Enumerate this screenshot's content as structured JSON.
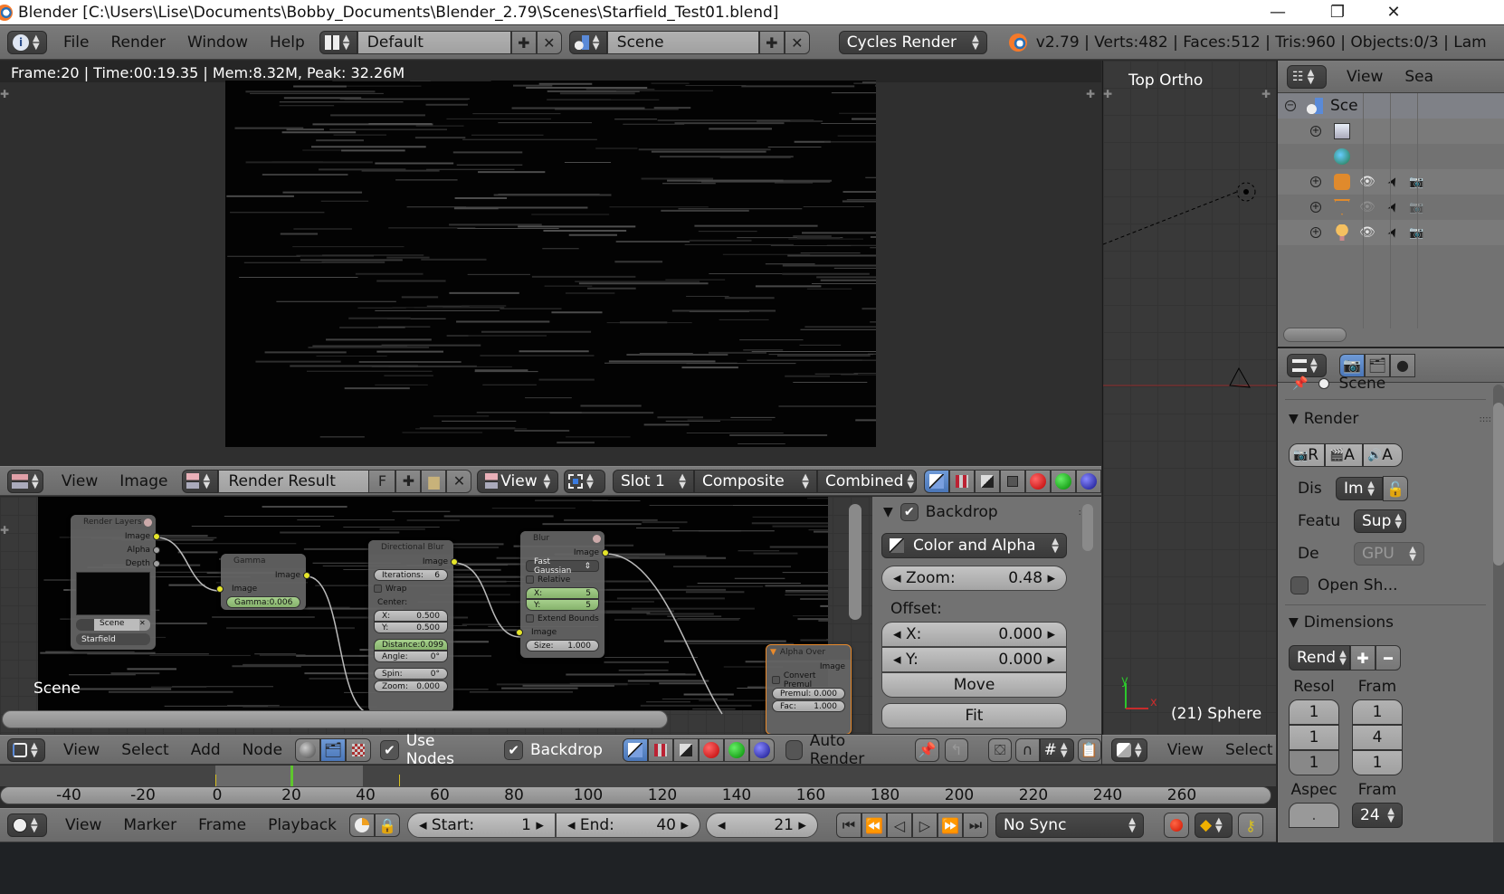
{
  "window": {
    "title": "Blender [C:\\Users\\Lise\\Documents\\Bobby_Documents\\Blender_2.79\\Scenes\\Starfield_Test01.blend]",
    "controls": {
      "minimize": "—",
      "restore": "❐",
      "close": "✕"
    }
  },
  "info_header": {
    "menus": [
      "File",
      "Render",
      "Window",
      "Help"
    ],
    "screen_layout": "Default",
    "scene": "Scene",
    "render_engine": "Cycles Render",
    "stats": "v2.79 | Verts:482 | Faces:512 | Tris:960 | Objects:0/3 | Lam"
  },
  "image_editor": {
    "render_info": "Frame:20 | Time:00:19.35 | Mem:8.32M, Peak: 32.26M",
    "header": {
      "menus": [
        "View",
        "Image"
      ],
      "image_name": "Render Result",
      "fake_user": "F",
      "view_mode": "View",
      "slot": "Slot 1",
      "layer": "Composite",
      "pass": "Combined"
    }
  },
  "viewport": {
    "label": "Top Ortho",
    "object_info": "(21) Sphere",
    "axis_x": "x",
    "axis_y": "y",
    "header": {
      "menus": [
        "View",
        "Select"
      ]
    }
  },
  "outliner": {
    "header": {
      "menus": [
        "View",
        "Sea"
      ]
    },
    "items": [
      {
        "label": "Sce",
        "icon": "scene-icon",
        "depth": 0,
        "expander": "minus"
      },
      {
        "label": "",
        "icon": "render-layers-icon",
        "depth": 1,
        "expander": "plus"
      },
      {
        "label": "",
        "icon": "world-icon",
        "depth": 1,
        "expander": ""
      },
      {
        "label": "",
        "icon": "camera-object-icon",
        "depth": 1,
        "expander": "plus",
        "visible": true
      },
      {
        "label": "",
        "icon": "mesh-object-icon",
        "depth": 1,
        "expander": "plus",
        "visible": false
      },
      {
        "label": "",
        "icon": "lamp-object-icon",
        "depth": 1,
        "expander": "plus",
        "visible": true
      }
    ]
  },
  "properties": {
    "context_path": "Scene",
    "render_panel": {
      "title": "Render",
      "buttons": [
        "R",
        "A",
        "A"
      ],
      "display_label": "Dis",
      "display_value": "Im",
      "feature_label": "Featu",
      "feature_value": "Sup",
      "device_label": "De",
      "device_value": "GPU",
      "open_shading": "Open Sh..."
    },
    "dimensions_panel": {
      "title": "Dimensions",
      "preset": "Rend",
      "resolution_label": "Resol",
      "resolution_values": [
        "1",
        "1",
        "1"
      ],
      "frame_range_label": "Fram",
      "frame_values": [
        "1",
        "4",
        "1"
      ],
      "aspect_label": "Aspec",
      "aspect_value": ".",
      "frame_rate_label": "Fram",
      "frame_rate": "24"
    }
  },
  "node_editor": {
    "scene_label": "Scene",
    "nodes": {
      "render_layers": {
        "title": "Render Layers",
        "outputs": [
          "Image",
          "Alpha",
          "Depth"
        ],
        "scene": "Scene",
        "layer": "Starfield"
      },
      "gamma": {
        "title": "Gamma",
        "output": "Image",
        "input": "Image",
        "gamma": "Gamma:",
        "gamma_value": "0.006"
      },
      "directional_blur": {
        "title": "Directional Blur",
        "output": "Image",
        "iterations_label": "Iterations:",
        "iterations": "6",
        "wrap": "Wrap",
        "center": "Center:",
        "x_label": "X:",
        "x": "0.500",
        "y_label": "Y:",
        "y": "0.500",
        "distance_label": "Distance:",
        "distance": "0.099",
        "angle_label": "Angle:",
        "angle": "0°",
        "spin_label": "Spin:",
        "spin": "0°",
        "zoom_label": "Zoom:",
        "zoom": "0.000"
      },
      "blur": {
        "title": "Blur",
        "output": "Image",
        "filter": "Fast Gaussian",
        "relative": "Relative",
        "x_label": "X:",
        "x": "5",
        "y_label": "Y:",
        "y": "5",
        "extend_bounds": "Extend Bounds",
        "input": "Image",
        "size_label": "Size:",
        "size": "1.000"
      },
      "alpha_over": {
        "title": "Alpha Over",
        "output": "Image",
        "convert_premul": "Convert Premul",
        "premul_label": "Premul:",
        "premul": "0.000",
        "fac_label": "Fac:",
        "fac": "1.000"
      }
    },
    "backdrop_panel": {
      "title": "Backdrop",
      "channels": "Color and Alpha",
      "zoom_label": "Zoom:",
      "zoom": "0.48",
      "offset_label": "Offset:",
      "x_label": "X:",
      "x": "0.000",
      "y_label": "Y:",
      "y": "0.000",
      "move": "Move",
      "fit": "Fit"
    },
    "header": {
      "menus": [
        "View",
        "Select",
        "Add",
        "Node"
      ],
      "use_nodes": "Use Nodes",
      "backdrop": "Backdrop",
      "auto_render": "Auto Render"
    }
  },
  "timeline": {
    "ruler_ticks": [
      "-40",
      "-20",
      "0",
      "20",
      "40",
      "60",
      "80",
      "100",
      "120",
      "140",
      "160",
      "180",
      "200",
      "220",
      "240",
      "260"
    ],
    "current_frame_marker": 20,
    "range_start": 0,
    "range_end": 40,
    "header": {
      "menus": [
        "View",
        "Marker",
        "Frame",
        "Playback"
      ],
      "start_label": "Start:",
      "start": "1",
      "end_label": "End:",
      "end": "40",
      "current_frame": "21",
      "sync": "No Sync"
    }
  },
  "colors": {
    "accent_blue": "#5680c2",
    "socket_yellow": "#e5e52a",
    "green_field": "#94c07a",
    "active_node_border": "#e88a2c",
    "playhead_green": "#5fc62e"
  }
}
